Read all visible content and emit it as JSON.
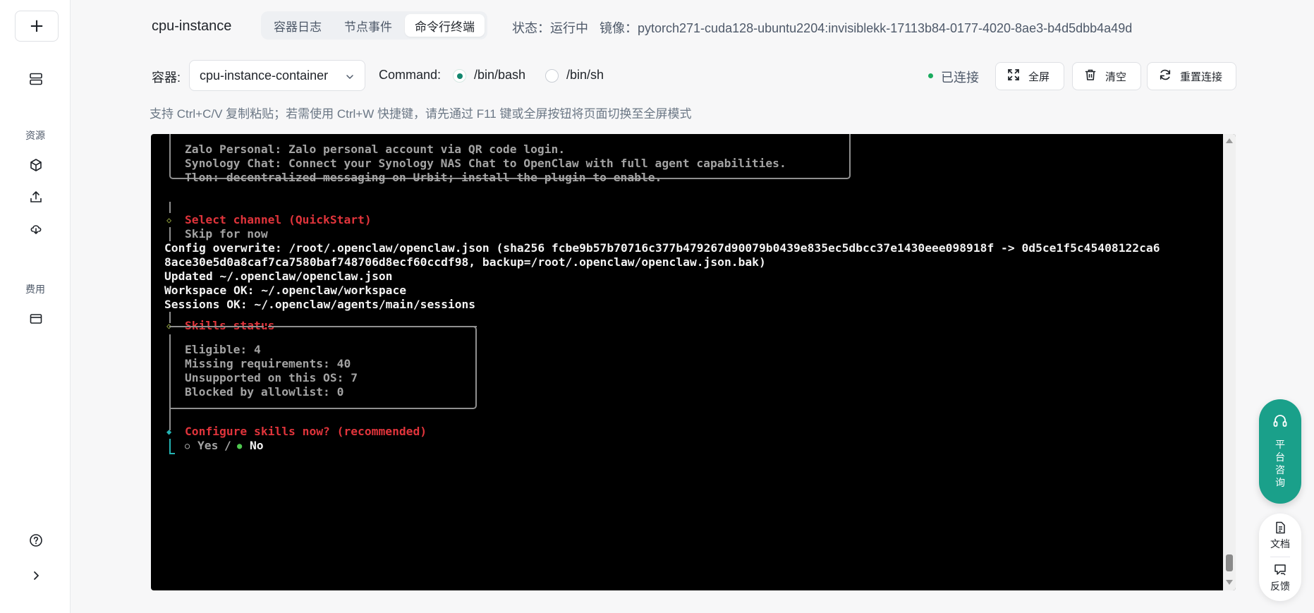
{
  "rail": {
    "add_label": "+",
    "section_resources": "资源",
    "section_billing": "费用"
  },
  "header": {
    "title": "cpu-instance",
    "tabs": [
      {
        "label": "容器日志",
        "active": false
      },
      {
        "label": "节点事件",
        "active": false
      },
      {
        "label": "命令行终端",
        "active": true
      }
    ],
    "status": "状态：运行中",
    "image": "镜像：pytorch271-cuda128-ubuntu2204:invisiblekk-17113b84-0177-4020-8ae3-b4d5dbb4a49d"
  },
  "controls": {
    "container_label": "容器:",
    "container_value": "cpu-instance-container",
    "command_label": "Command:",
    "shell_options": [
      {
        "label": "/bin/bash",
        "selected": true
      },
      {
        "label": "/bin/sh",
        "selected": false
      }
    ],
    "connection_status": "已连接",
    "fullscreen_label": "全屏",
    "clear_label": "清空",
    "reconnect_label": "重置连接"
  },
  "hint": "支持 Ctrl+C/V 复制粘贴；若需使用 Ctrl+W 快捷键，请先通过 F11 键或全屏按钮将页面切换至全屏模式",
  "terminal": {
    "lines": {
      "l1": "Zalo Personal: Zalo personal account via QR code login.",
      "l2": "Synology Chat: Connect your Synology NAS Chat to OpenClaw with full agent capabilities.",
      "l3": "Tlon: decentralized messaging on Urbit; install the plugin to enable.",
      "select_channel": "Select channel (QuickStart)",
      "skip": "Skip for now",
      "cfg1": "Config overwrite: /root/.openclaw/openclaw.json (sha256 fcbe9b57b70716c377b479267d90079b0439e835ec5dbcc37e1430eee098918f -> 0d5ce1f5c45408122ca6",
      "cfg2": "8ace30e5d0a8caf7ca7580baf748706d8ecf60ccdf98, backup=/root/.openclaw/openclaw.json.bak)",
      "updated": "Updated ~/.openclaw/openclaw.json",
      "workspace": "Workspace OK: ~/.openclaw/workspace",
      "sessions": "Sessions OK: ~/.openclaw/agents/main/sessions",
      "skills_title": "Skills status",
      "eligible": "Eligible: 4",
      "missing": "Missing requirements: 40",
      "unsupported": "Unsupported on this OS: 7",
      "blocked": "Blocked by allowlist: 0",
      "configure": "Configure skills now? (recommended)",
      "yes": "Yes",
      "slash": "/",
      "no": "No"
    }
  },
  "floating": {
    "consult_label": "平台咨询",
    "docs_label": "文档",
    "feedback_label": "反馈"
  },
  "colors": {
    "accent": "#12866e",
    "connected": "#1aab5e",
    "consult_bg": "#1aa08a",
    "terminal_bg": "#000000",
    "terminal_red": "#e0343b"
  }
}
